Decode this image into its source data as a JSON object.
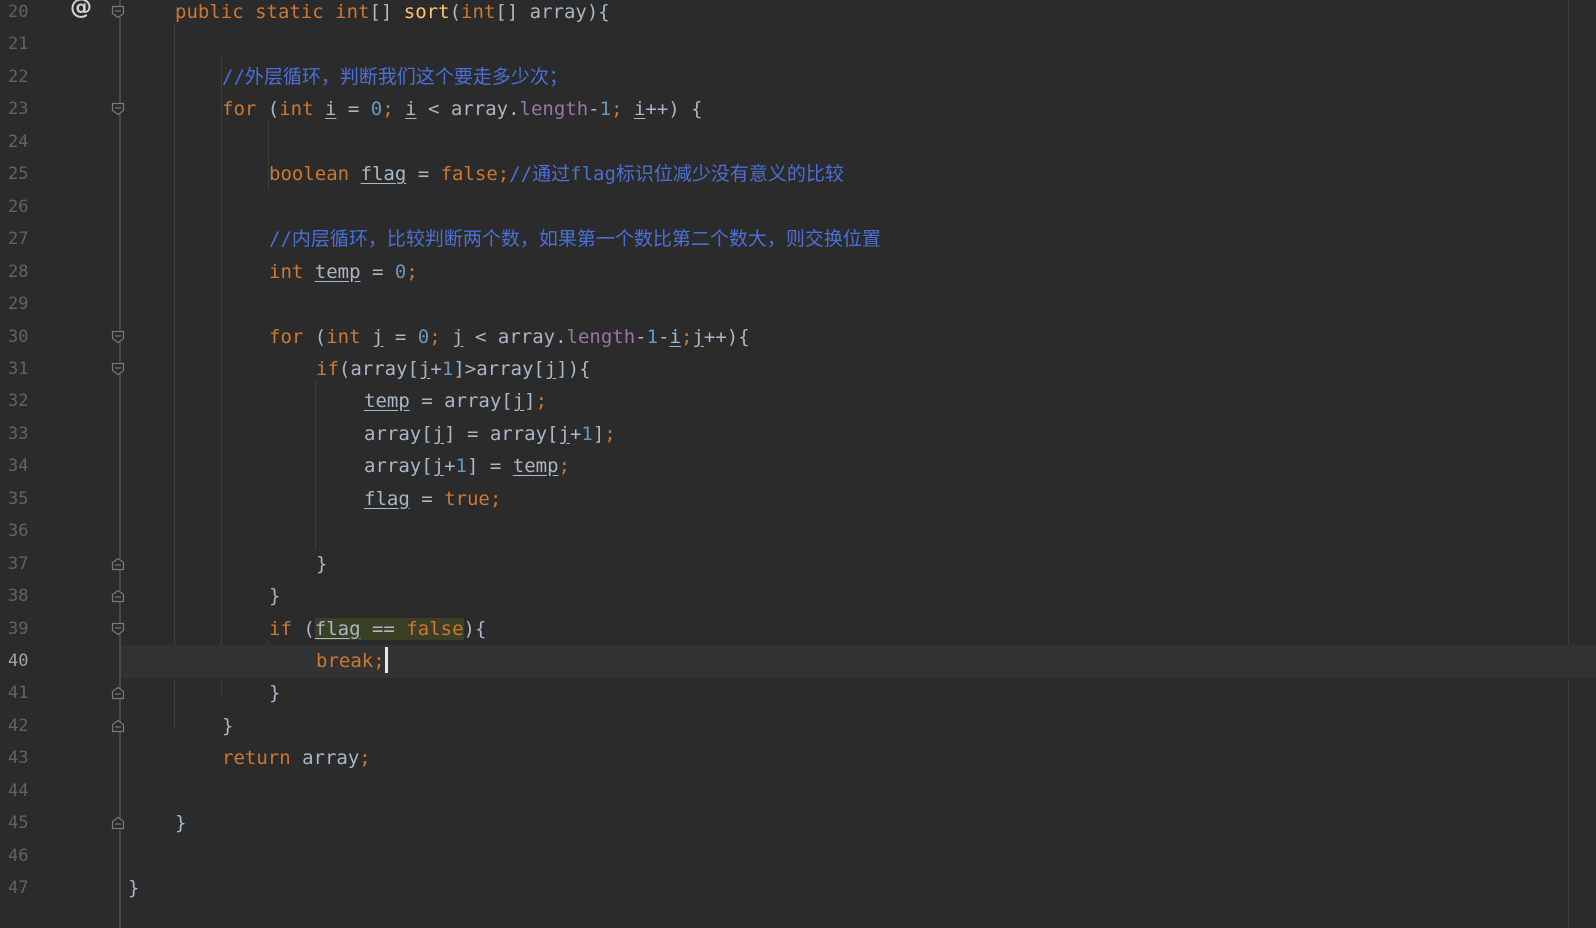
{
  "editor": {
    "current_line": 40,
    "gutter_marker": "@",
    "lines": [
      {
        "num": "20",
        "tokens": [
          [
            "kw",
            "public static int"
          ],
          [
            "pl",
            "[] "
          ],
          [
            "fn",
            "sort"
          ],
          [
            "pl",
            "("
          ],
          [
            "kw",
            "int"
          ],
          [
            "pl",
            "[] array){"
          ]
        ]
      },
      {
        "num": "21",
        "tokens": []
      },
      {
        "num": "22",
        "tokens": [
          [
            "cm",
            "//外层循环，判断我们这个要走多少次；"
          ]
        ]
      },
      {
        "num": "23",
        "tokens": [
          [
            "kw",
            "for "
          ],
          [
            "pl",
            "("
          ],
          [
            "kw",
            "int "
          ],
          [
            "plu",
            "i"
          ],
          [
            "pl",
            " = "
          ],
          [
            "num",
            "0"
          ],
          [
            "kw",
            "; "
          ],
          [
            "plu",
            "i"
          ],
          [
            "pl",
            " < array."
          ],
          [
            "fd",
            "length"
          ],
          [
            "pl",
            "-"
          ],
          [
            "num",
            "1"
          ],
          [
            "kw",
            "; "
          ],
          [
            "plu",
            "i"
          ],
          [
            "pl",
            "++) {"
          ]
        ]
      },
      {
        "num": "24",
        "tokens": []
      },
      {
        "num": "25",
        "tokens": [
          [
            "kw",
            "boolean "
          ],
          [
            "plu",
            "flag"
          ],
          [
            "pl",
            " = "
          ],
          [
            "kw",
            "false;"
          ],
          [
            "cm",
            "//通过flag标识位减少没有意义的比较"
          ]
        ]
      },
      {
        "num": "26",
        "tokens": []
      },
      {
        "num": "27",
        "tokens": [
          [
            "cm",
            "//内层循环，比较判断两个数，如果第一个数比第二个数大，则交换位置"
          ]
        ]
      },
      {
        "num": "28",
        "tokens": [
          [
            "kw",
            "int "
          ],
          [
            "plu",
            "temp"
          ],
          [
            "pl",
            " = "
          ],
          [
            "num",
            "0"
          ],
          [
            "kw",
            ";"
          ]
        ]
      },
      {
        "num": "29",
        "tokens": []
      },
      {
        "num": "30",
        "tokens": [
          [
            "kw",
            "for "
          ],
          [
            "pl",
            "("
          ],
          [
            "kw",
            "int "
          ],
          [
            "plu",
            "j"
          ],
          [
            "pl",
            " = "
          ],
          [
            "num",
            "0"
          ],
          [
            "kw",
            "; "
          ],
          [
            "plu",
            "j"
          ],
          [
            "pl",
            " < array."
          ],
          [
            "fd",
            "length"
          ],
          [
            "pl",
            "-"
          ],
          [
            "num",
            "1"
          ],
          [
            "pl",
            "-"
          ],
          [
            "plu",
            "i"
          ],
          [
            "kw",
            ";"
          ],
          [
            "plu",
            "j"
          ],
          [
            "pl",
            "++){"
          ]
        ]
      },
      {
        "num": "31",
        "tokens": [
          [
            "kw",
            "if"
          ],
          [
            "pl",
            "(array["
          ],
          [
            "plu",
            "j"
          ],
          [
            "pl",
            "+"
          ],
          [
            "num",
            "1"
          ],
          [
            "pl",
            "]>array["
          ],
          [
            "plu",
            "j"
          ],
          [
            "pl",
            "]){"
          ]
        ]
      },
      {
        "num": "32",
        "tokens": [
          [
            "plu",
            "temp"
          ],
          [
            "pl",
            " = array["
          ],
          [
            "plu",
            "j"
          ],
          [
            "pl",
            "]"
          ],
          [
            "kw",
            ";"
          ]
        ]
      },
      {
        "num": "33",
        "tokens": [
          [
            "pl",
            "array["
          ],
          [
            "plu",
            "j"
          ],
          [
            "pl",
            "] = array["
          ],
          [
            "plu",
            "j"
          ],
          [
            "pl",
            "+"
          ],
          [
            "num",
            "1"
          ],
          [
            "pl",
            "]"
          ],
          [
            "kw",
            ";"
          ]
        ]
      },
      {
        "num": "34",
        "tokens": [
          [
            "pl",
            "array["
          ],
          [
            "plu",
            "j"
          ],
          [
            "pl",
            "+"
          ],
          [
            "num",
            "1"
          ],
          [
            "pl",
            "] = "
          ],
          [
            "plu",
            "temp"
          ],
          [
            "kw",
            ";"
          ]
        ]
      },
      {
        "num": "35",
        "tokens": [
          [
            "plu",
            "flag"
          ],
          [
            "pl",
            " = "
          ],
          [
            "kw",
            "true;"
          ]
        ]
      },
      {
        "num": "36",
        "tokens": []
      },
      {
        "num": "37",
        "tokens": [
          [
            "pl",
            "}"
          ]
        ]
      },
      {
        "num": "38",
        "tokens": [
          [
            "pl",
            "}"
          ]
        ]
      },
      {
        "num": "39",
        "tokens": [
          [
            "kw",
            "if "
          ],
          [
            "pl",
            "("
          ],
          [
            "hlu",
            "flag"
          ],
          [
            "hl",
            " == "
          ],
          [
            "hlk",
            "false"
          ],
          [
            "pl",
            "){"
          ]
        ]
      },
      {
        "num": "40",
        "tokens": [
          [
            "kw",
            "break;"
          ]
        ]
      },
      {
        "num": "41",
        "tokens": [
          [
            "pl",
            "}"
          ]
        ]
      },
      {
        "num": "42",
        "tokens": [
          [
            "pl",
            "}"
          ]
        ]
      },
      {
        "num": "43",
        "tokens": [
          [
            "kw",
            "return "
          ],
          [
            "pl",
            "array"
          ],
          [
            "kw",
            ";"
          ]
        ]
      },
      {
        "num": "44",
        "tokens": []
      },
      {
        "num": "45",
        "tokens": [
          [
            "pl",
            "}"
          ]
        ]
      },
      {
        "num": "46",
        "tokens": []
      },
      {
        "num": "47",
        "tokens": [
          [
            "pl",
            "}"
          ]
        ]
      }
    ]
  }
}
